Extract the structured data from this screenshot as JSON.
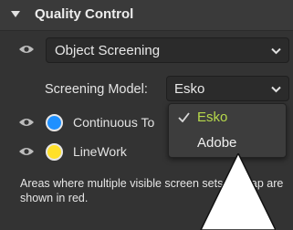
{
  "panel": {
    "title": "Quality Control"
  },
  "object_screening": {
    "selected": "Object Screening"
  },
  "screening_model": {
    "label": "Screening Model:",
    "selected": "Esko",
    "options": [
      "Esko",
      "Adobe"
    ]
  },
  "screens": [
    {
      "label": "Continuous To",
      "color": "#1e90ff"
    },
    {
      "label": "LineWork",
      "color": "#ffe02a"
    }
  ],
  "note": "Areas where multiple visible screen sets overlap are shown in red.",
  "colors": {
    "panel_bg": "#333333",
    "selected_option": "#b7d94b",
    "field_bg": "#2b2b2b"
  },
  "icons": [
    "chevron-down-icon",
    "eye-icon",
    "caret-down-icon",
    "checkmark-icon"
  ]
}
